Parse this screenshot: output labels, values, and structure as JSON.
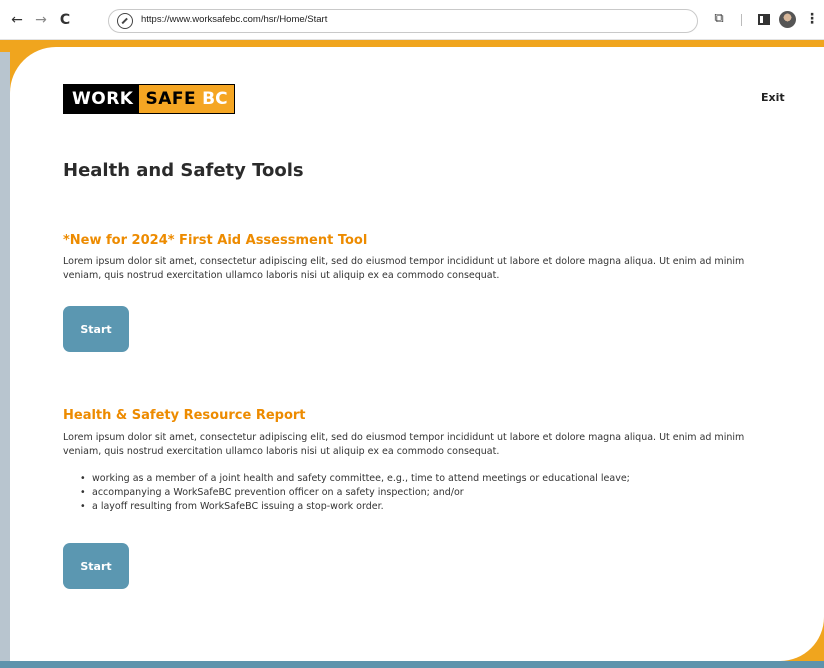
{
  "browser": {
    "url": "https://www.worksafebc.com/hsr/Home/Start",
    "back_glyph": "←",
    "forward_glyph": "→",
    "reload_glyph": "C",
    "menu_glyph": "⋮",
    "ext_glyph": "⧉"
  },
  "brand": {
    "logo_work": "WORK",
    "logo_safe": "SAFE",
    "logo_bc": "BC",
    "colors": {
      "orange": "#f0a51e",
      "section_title": "#ed8b00",
      "button": "#5b97b1",
      "bottom_bar": "#5e93ac"
    }
  },
  "header": {
    "exit_label": "Exit"
  },
  "page": {
    "title": "Health and Safety Tools"
  },
  "sections": [
    {
      "title": "*New for 2024* First Aid Assessment Tool",
      "description": "Lorem ipsum dolor sit amet, consectetur adipiscing elit, sed do eiusmod tempor incididunt ut labore et dolore magna aliqua. Ut enim ad minim veniam, quis nostrud exercitation ullamco laboris nisi ut aliquip ex ea commodo consequat.",
      "button_label": "Start"
    },
    {
      "title": "Health & Safety Resource Report",
      "description": "Lorem ipsum dolor sit amet, consectetur adipiscing elit, sed do eiusmod tempor incididunt ut labore et dolore magna aliqua. Ut enim ad minim veniam, quis nostrud exercitation ullamco laboris nisi ut aliquip ex ea commodo consequat.",
      "bullets": [
        "working as a member of a joint health and safety committee, e.g., time to attend meetings or educational leave;",
        "accompanying a WorkSafeBC prevention officer on a safety inspection; and/or",
        "a layoff resulting from WorkSafeBC issuing a stop-work order."
      ],
      "button_label": "Start"
    }
  ]
}
